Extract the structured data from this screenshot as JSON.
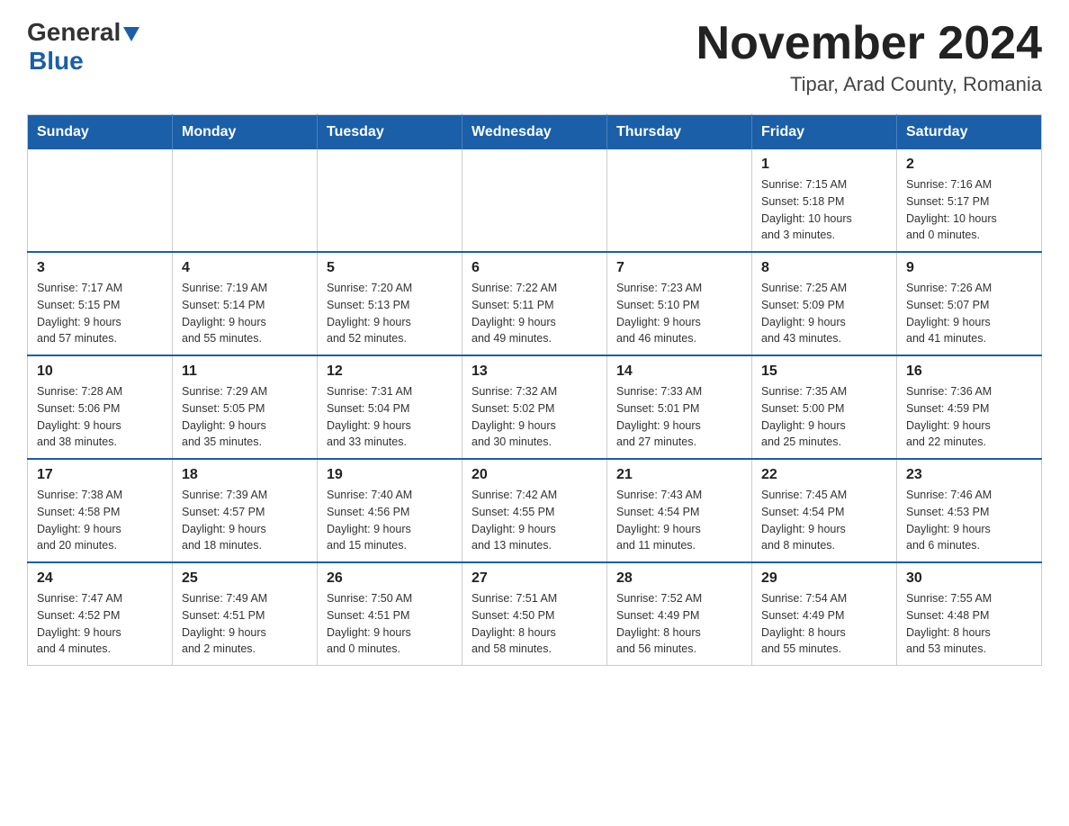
{
  "header": {
    "title": "November 2024",
    "subtitle": "Tipar, Arad County, Romania",
    "logo_general": "General",
    "logo_blue": "Blue"
  },
  "weekdays": [
    "Sunday",
    "Monday",
    "Tuesday",
    "Wednesday",
    "Thursday",
    "Friday",
    "Saturday"
  ],
  "weeks": [
    {
      "days": [
        {
          "number": "",
          "info": ""
        },
        {
          "number": "",
          "info": ""
        },
        {
          "number": "",
          "info": ""
        },
        {
          "number": "",
          "info": ""
        },
        {
          "number": "",
          "info": ""
        },
        {
          "number": "1",
          "info": "Sunrise: 7:15 AM\nSunset: 5:18 PM\nDaylight: 10 hours\nand 3 minutes."
        },
        {
          "number": "2",
          "info": "Sunrise: 7:16 AM\nSunset: 5:17 PM\nDaylight: 10 hours\nand 0 minutes."
        }
      ]
    },
    {
      "days": [
        {
          "number": "3",
          "info": "Sunrise: 7:17 AM\nSunset: 5:15 PM\nDaylight: 9 hours\nand 57 minutes."
        },
        {
          "number": "4",
          "info": "Sunrise: 7:19 AM\nSunset: 5:14 PM\nDaylight: 9 hours\nand 55 minutes."
        },
        {
          "number": "5",
          "info": "Sunrise: 7:20 AM\nSunset: 5:13 PM\nDaylight: 9 hours\nand 52 minutes."
        },
        {
          "number": "6",
          "info": "Sunrise: 7:22 AM\nSunset: 5:11 PM\nDaylight: 9 hours\nand 49 minutes."
        },
        {
          "number": "7",
          "info": "Sunrise: 7:23 AM\nSunset: 5:10 PM\nDaylight: 9 hours\nand 46 minutes."
        },
        {
          "number": "8",
          "info": "Sunrise: 7:25 AM\nSunset: 5:09 PM\nDaylight: 9 hours\nand 43 minutes."
        },
        {
          "number": "9",
          "info": "Sunrise: 7:26 AM\nSunset: 5:07 PM\nDaylight: 9 hours\nand 41 minutes."
        }
      ]
    },
    {
      "days": [
        {
          "number": "10",
          "info": "Sunrise: 7:28 AM\nSunset: 5:06 PM\nDaylight: 9 hours\nand 38 minutes."
        },
        {
          "number": "11",
          "info": "Sunrise: 7:29 AM\nSunset: 5:05 PM\nDaylight: 9 hours\nand 35 minutes."
        },
        {
          "number": "12",
          "info": "Sunrise: 7:31 AM\nSunset: 5:04 PM\nDaylight: 9 hours\nand 33 minutes."
        },
        {
          "number": "13",
          "info": "Sunrise: 7:32 AM\nSunset: 5:02 PM\nDaylight: 9 hours\nand 30 minutes."
        },
        {
          "number": "14",
          "info": "Sunrise: 7:33 AM\nSunset: 5:01 PM\nDaylight: 9 hours\nand 27 minutes."
        },
        {
          "number": "15",
          "info": "Sunrise: 7:35 AM\nSunset: 5:00 PM\nDaylight: 9 hours\nand 25 minutes."
        },
        {
          "number": "16",
          "info": "Sunrise: 7:36 AM\nSunset: 4:59 PM\nDaylight: 9 hours\nand 22 minutes."
        }
      ]
    },
    {
      "days": [
        {
          "number": "17",
          "info": "Sunrise: 7:38 AM\nSunset: 4:58 PM\nDaylight: 9 hours\nand 20 minutes."
        },
        {
          "number": "18",
          "info": "Sunrise: 7:39 AM\nSunset: 4:57 PM\nDaylight: 9 hours\nand 18 minutes."
        },
        {
          "number": "19",
          "info": "Sunrise: 7:40 AM\nSunset: 4:56 PM\nDaylight: 9 hours\nand 15 minutes."
        },
        {
          "number": "20",
          "info": "Sunrise: 7:42 AM\nSunset: 4:55 PM\nDaylight: 9 hours\nand 13 minutes."
        },
        {
          "number": "21",
          "info": "Sunrise: 7:43 AM\nSunset: 4:54 PM\nDaylight: 9 hours\nand 11 minutes."
        },
        {
          "number": "22",
          "info": "Sunrise: 7:45 AM\nSunset: 4:54 PM\nDaylight: 9 hours\nand 8 minutes."
        },
        {
          "number": "23",
          "info": "Sunrise: 7:46 AM\nSunset: 4:53 PM\nDaylight: 9 hours\nand 6 minutes."
        }
      ]
    },
    {
      "days": [
        {
          "number": "24",
          "info": "Sunrise: 7:47 AM\nSunset: 4:52 PM\nDaylight: 9 hours\nand 4 minutes."
        },
        {
          "number": "25",
          "info": "Sunrise: 7:49 AM\nSunset: 4:51 PM\nDaylight: 9 hours\nand 2 minutes."
        },
        {
          "number": "26",
          "info": "Sunrise: 7:50 AM\nSunset: 4:51 PM\nDaylight: 9 hours\nand 0 minutes."
        },
        {
          "number": "27",
          "info": "Sunrise: 7:51 AM\nSunset: 4:50 PM\nDaylight: 8 hours\nand 58 minutes."
        },
        {
          "number": "28",
          "info": "Sunrise: 7:52 AM\nSunset: 4:49 PM\nDaylight: 8 hours\nand 56 minutes."
        },
        {
          "number": "29",
          "info": "Sunrise: 7:54 AM\nSunset: 4:49 PM\nDaylight: 8 hours\nand 55 minutes."
        },
        {
          "number": "30",
          "info": "Sunrise: 7:55 AM\nSunset: 4:48 PM\nDaylight: 8 hours\nand 53 minutes."
        }
      ]
    }
  ]
}
